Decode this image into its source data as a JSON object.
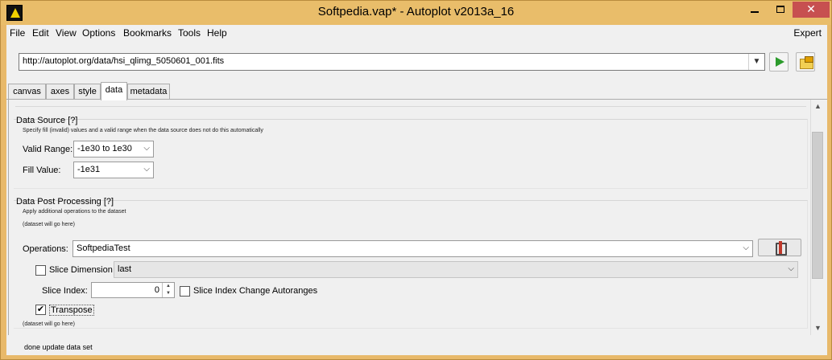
{
  "window": {
    "title": "Softpedia.vap* - Autoplot v2013a_16"
  },
  "menu": {
    "items": [
      "File",
      "Edit",
      "View",
      "Options",
      "Bookmarks",
      "Tools",
      "Help"
    ],
    "expert": "Expert"
  },
  "address": {
    "url": "http://autoplot.org/data/hsi_qlimg_5050601_001.fits"
  },
  "tabs": [
    {
      "label": "canvas"
    },
    {
      "label": "axes"
    },
    {
      "label": "style"
    },
    {
      "label": "data"
    },
    {
      "label": "metadata"
    }
  ],
  "data_source": {
    "title": "Data Source [?]",
    "hint": "Specify fill (invalid) values and a valid range when the data source does not do this automatically",
    "valid_range_label": "Valid Range:",
    "valid_range_value": "-1e30 to 1e30",
    "fill_value_label": "Fill Value:",
    "fill_value_value": "-1e31"
  },
  "post_processing": {
    "title": "Data Post Processing [?]",
    "hint": "Apply additional operations to the dataset",
    "dataset_placeholder_1": "(dataset will go here)",
    "operations_label": "Operations:",
    "operations_value": "SoftpediaTest",
    "slice_dimension_label": "Slice Dimension",
    "slice_dimension_value": "last",
    "slice_index_label": "Slice Index:",
    "slice_index_value": "0",
    "slice_autorange_label": "Slice Index Change Autoranges",
    "transpose_label": "Transpose",
    "transpose_check": "✔",
    "dataset_placeholder_2": "(dataset will go here)"
  },
  "status": {
    "text": "done update data set"
  }
}
